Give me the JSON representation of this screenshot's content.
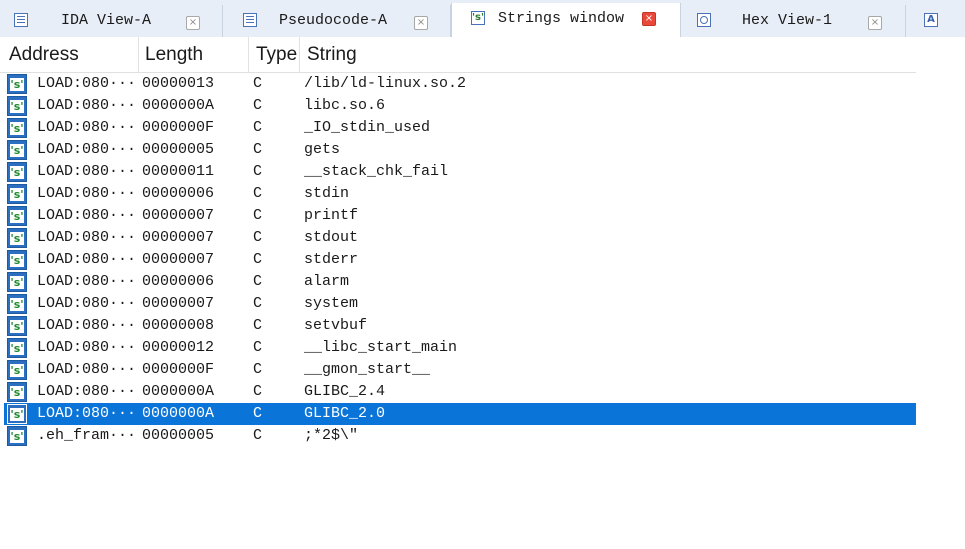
{
  "tabs": [
    {
      "label": "IDA View-A",
      "icon": "listing-icon",
      "active": false
    },
    {
      "label": "Pseudocode-A",
      "icon": "pseudocode-icon",
      "active": false
    },
    {
      "label": "Strings window",
      "icon": "strings-icon",
      "active": true
    },
    {
      "label": "Hex View-1",
      "icon": "hex-icon",
      "active": false
    },
    {
      "label": "",
      "icon": "structures-icon",
      "active": false
    }
  ],
  "columns": {
    "address": "Address",
    "length": "Length",
    "type": "Type",
    "string": "String"
  },
  "icons": {
    "string_glyph": "'s'",
    "close_glyph": "×",
    "structures_glyph": "A"
  },
  "colors": {
    "selection": "#0a74d8",
    "active_close": "#e8493a",
    "tabbar_bg": "#e8eef7"
  },
  "selected_index": 15,
  "rows": [
    {
      "address": "LOAD:080···",
      "length": "00000013",
      "type": "C",
      "string": "/lib/ld-linux.so.2"
    },
    {
      "address": "LOAD:080···",
      "length": "0000000A",
      "type": "C",
      "string": "libc.so.6"
    },
    {
      "address": "LOAD:080···",
      "length": "0000000F",
      "type": "C",
      "string": "_IO_stdin_used"
    },
    {
      "address": "LOAD:080···",
      "length": "00000005",
      "type": "C",
      "string": "gets"
    },
    {
      "address": "LOAD:080···",
      "length": "00000011",
      "type": "C",
      "string": "__stack_chk_fail"
    },
    {
      "address": "LOAD:080···",
      "length": "00000006",
      "type": "C",
      "string": "stdin"
    },
    {
      "address": "LOAD:080···",
      "length": "00000007",
      "type": "C",
      "string": "printf"
    },
    {
      "address": "LOAD:080···",
      "length": "00000007",
      "type": "C",
      "string": "stdout"
    },
    {
      "address": "LOAD:080···",
      "length": "00000007",
      "type": "C",
      "string": "stderr"
    },
    {
      "address": "LOAD:080···",
      "length": "00000006",
      "type": "C",
      "string": "alarm"
    },
    {
      "address": "LOAD:080···",
      "length": "00000007",
      "type": "C",
      "string": "system"
    },
    {
      "address": "LOAD:080···",
      "length": "00000008",
      "type": "C",
      "string": "setvbuf"
    },
    {
      "address": "LOAD:080···",
      "length": "00000012",
      "type": "C",
      "string": "__libc_start_main"
    },
    {
      "address": "LOAD:080···",
      "length": "0000000F",
      "type": "C",
      "string": "__gmon_start__"
    },
    {
      "address": "LOAD:080···",
      "length": "0000000A",
      "type": "C",
      "string": "GLIBC_2.4"
    },
    {
      "address": "LOAD:080···",
      "length": "0000000A",
      "type": "C",
      "string": "GLIBC_2.0"
    },
    {
      "address": ".eh_fram···",
      "length": "00000005",
      "type": "C",
      "string": ";*2$\\\""
    }
  ]
}
